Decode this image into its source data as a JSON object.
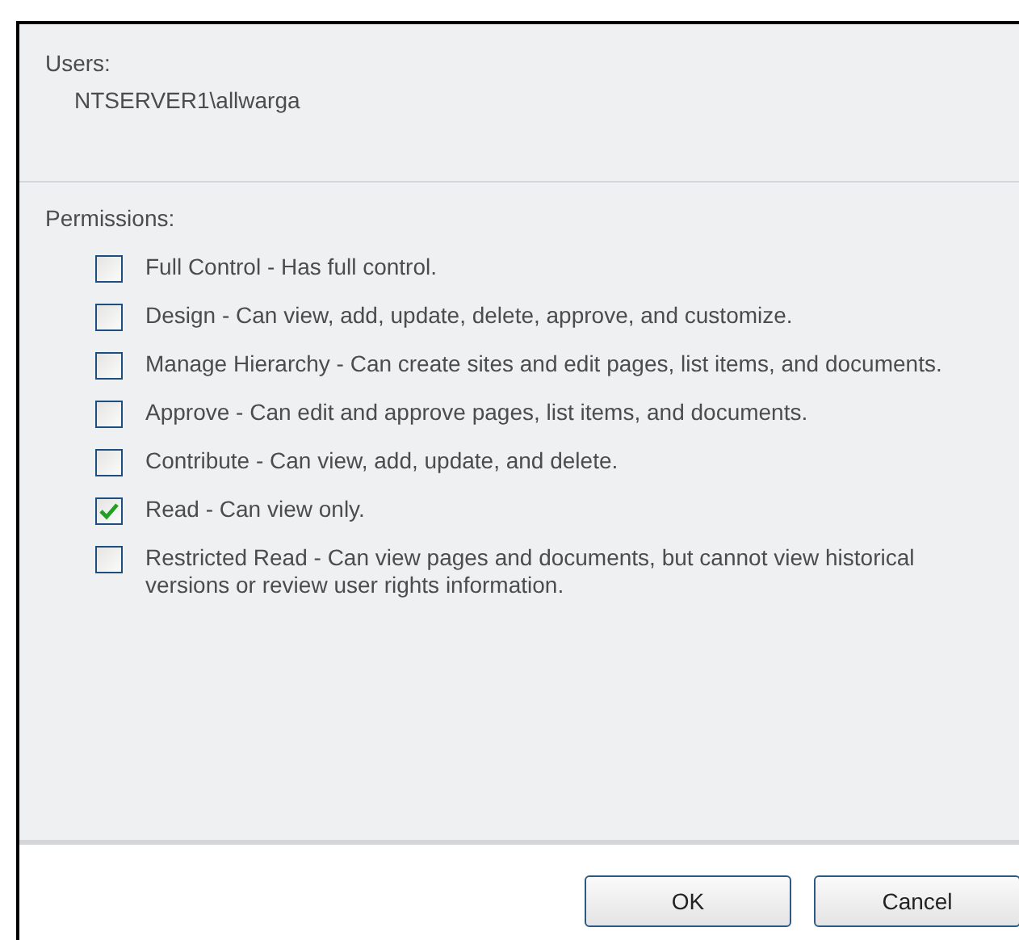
{
  "users": {
    "label": "Users:",
    "value": "NTSERVER1\\allwarga"
  },
  "permissions": {
    "label": "Permissions:",
    "items": [
      {
        "label": "Full Control - Has full control.",
        "checked": false
      },
      {
        "label": "Design - Can view, add, update, delete, approve, and customize.",
        "checked": false
      },
      {
        "label": "Manage Hierarchy - Can create sites and edit pages, list items, and documents.",
        "checked": false
      },
      {
        "label": "Approve - Can edit and approve pages, list items, and documents.",
        "checked": false
      },
      {
        "label": "Contribute - Can view, add, update, and delete.",
        "checked": false
      },
      {
        "label": "Read - Can view only.",
        "checked": true
      },
      {
        "label": "Restricted Read - Can view pages and documents, but cannot view historical versions or review user rights information.",
        "checked": false
      }
    ]
  },
  "buttons": [
    "OK",
    "Cancel"
  ]
}
